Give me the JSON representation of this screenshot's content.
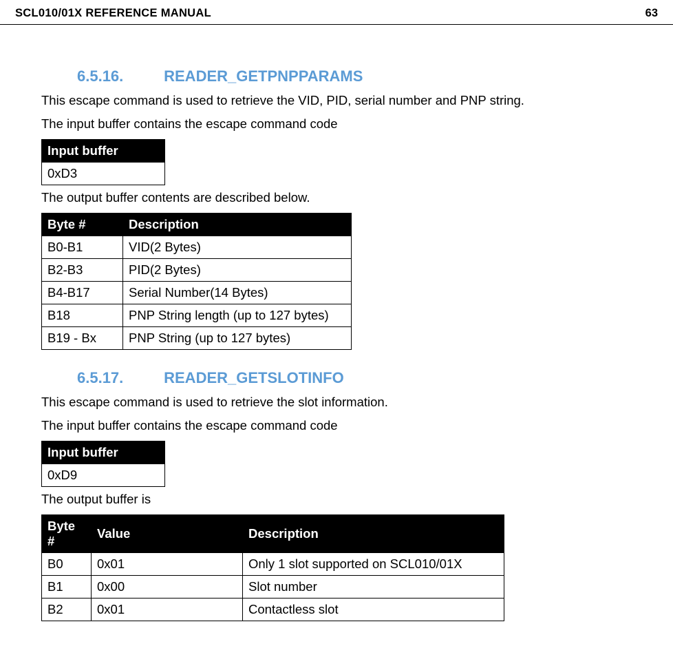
{
  "header": {
    "title": "SCL010/01X REFERENCE MANUAL",
    "page": "63"
  },
  "section1": {
    "num": "6.5.16.",
    "title": "READER_GETPNPPARAMS",
    "p1": "This escape command is used to retrieve the VID, PID, serial number and PNP string.",
    "p2": "The input buffer contains the escape command code",
    "input_header": "Input buffer",
    "input_value": "0xD3",
    "p3": "The output buffer contents are described below.",
    "out_h1": "Byte #",
    "out_h2": "Description",
    "rows": [
      {
        "b": "B0-B1",
        "d": "VID(2 Bytes)"
      },
      {
        "b": "B2-B3",
        "d": "PID(2 Bytes)"
      },
      {
        "b": "B4-B17",
        "d": "Serial Number(14 Bytes)"
      },
      {
        "b": "B18",
        "d": "PNP String length (up to 127 bytes)"
      },
      {
        "b": "B19 - Bx",
        "d": "PNP String (up to 127 bytes)"
      }
    ]
  },
  "section2": {
    "num": "6.5.17.",
    "title": "READER_GETSLOTINFO",
    "p1": "This escape command is used to retrieve the slot information.",
    "p2": "The input buffer contains the escape command code",
    "input_header": "Input buffer",
    "input_value": "0xD9",
    "p3": "The output buffer is",
    "out_h1": "Byte #",
    "out_h2": "Value",
    "out_h3": "Description",
    "rows": [
      {
        "b": "B0",
        "v": "0x01",
        "d": "Only 1 slot supported on SCL010/01X"
      },
      {
        "b": "B1",
        "v": "0x00",
        "d": "Slot number"
      },
      {
        "b": "B2",
        "v": "0x01",
        "d": "Contactless slot"
      }
    ]
  }
}
